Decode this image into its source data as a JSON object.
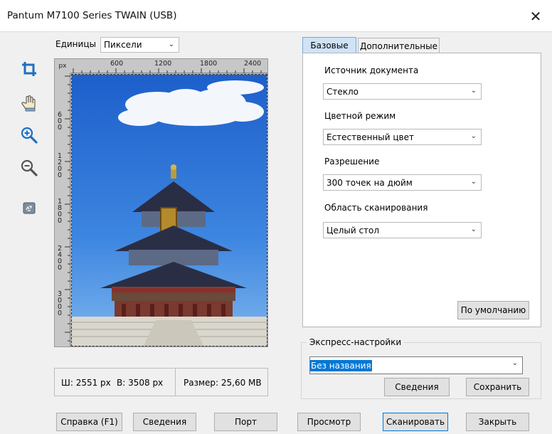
{
  "window": {
    "title": "Pantum M7100 Series TWAIN (USB)",
    "close_glyph": "✕"
  },
  "toolbar": {
    "tools": [
      {
        "name": "crop-icon"
      },
      {
        "name": "hand-icon"
      },
      {
        "name": "zoom-in-icon"
      },
      {
        "name": "zoom-out-icon"
      },
      {
        "name": "recycle-icon"
      }
    ]
  },
  "units": {
    "label": "Единицы",
    "value": "Пиксели"
  },
  "ruler": {
    "unit": "px",
    "top_ticks": [
      "600",
      "1200",
      "1800",
      "2400"
    ],
    "left_ticks": [
      "600",
      "1200",
      "1800",
      "2400",
      "3000"
    ]
  },
  "info": {
    "width": "Ш: 2551 px",
    "height": "В: 3508 px",
    "size": "Размер: 25,60 MB"
  },
  "tabs": [
    {
      "label": "Базовые",
      "active": true
    },
    {
      "label": "Дополнительные",
      "active": false
    }
  ],
  "basic": {
    "source_label": "Источник документа",
    "source_value": "Стекло",
    "color_label": "Цветной режим",
    "color_value": "Естественный цвет",
    "resolution_label": "Разрешение",
    "resolution_value": "300 точек на дюйм",
    "area_label": "Область сканирования",
    "area_value": "Целый стол",
    "default_button": "По умолчанию"
  },
  "express": {
    "legend": "Экспресс-настройки",
    "value": "Без названия",
    "details_button": "Сведения",
    "save_button": "Сохранить"
  },
  "footer": {
    "help": "Справка (F1)",
    "details": "Сведения",
    "port": "Порт",
    "preview": "Просмотр",
    "scan": "Сканировать",
    "close": "Закрыть"
  },
  "colors": {
    "accent": "#0078d7",
    "tab_active": "#cfe3f7",
    "dialog_bg": "#f0f0f0"
  }
}
